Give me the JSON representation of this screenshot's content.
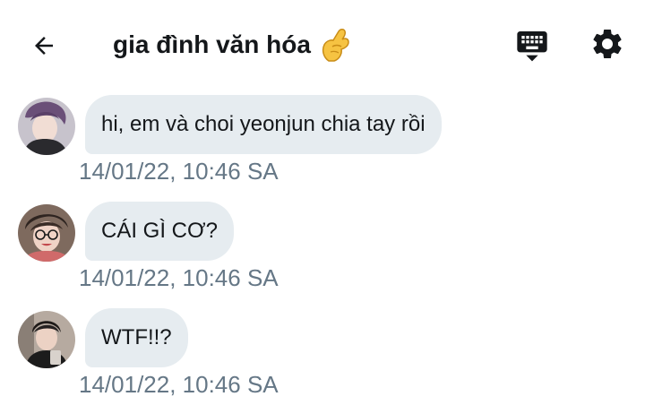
{
  "header": {
    "title": "gia đình văn hóa",
    "title_emoji": "pinching-hand-emoji",
    "back_icon": "arrow-left-icon",
    "keyboard_icon": "keyboard-hide-icon",
    "settings_icon": "gear-icon"
  },
  "colors": {
    "bubble_background": "#e6ecf0",
    "text_primary": "#14171a",
    "text_secondary": "#657786",
    "emoji_yellow": "#f6c342"
  },
  "messages": [
    {
      "text": "hi, em và choi yeonjun chia tay rồi",
      "timestamp": "14/01/22, 10:46 SA"
    },
    {
      "text": "CÁI GÌ CƠ?",
      "timestamp": "14/01/22, 10:46 SA"
    },
    {
      "text": "WTF!!?",
      "timestamp": "14/01/22, 10:46 SA"
    }
  ]
}
